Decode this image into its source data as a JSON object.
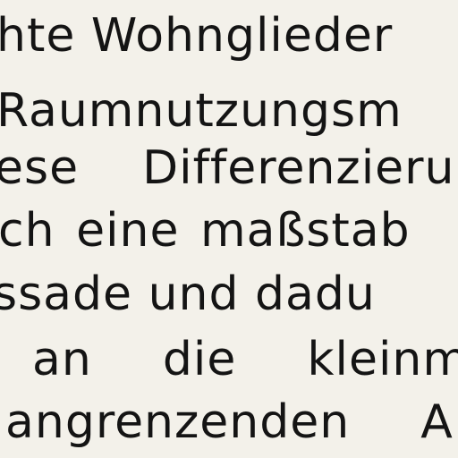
{
  "document": {
    "lines": [
      "hte Wohnglieder",
      "Raumnutzungsm",
      "ese  Differenzieru",
      "ch eine maßstab",
      "ssade und dadu",
      "an  die  kleinm",
      "angrenzenden  A"
    ]
  }
}
